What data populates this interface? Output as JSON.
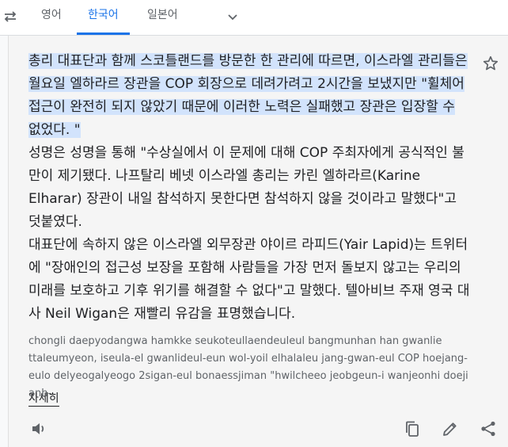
{
  "header": {
    "tabs": [
      {
        "label": "영어",
        "active": false
      },
      {
        "label": "한국어",
        "active": true
      },
      {
        "label": "일본어",
        "active": false
      }
    ],
    "swap_icon": "swap-icon",
    "more_languages_icon": "chevron-down-icon"
  },
  "translation": {
    "highlighted": "총리 대표단과 함께 스코틀랜드를 방문한 한 관리에 따르면, 이스라엘 관리들은 월요일 엘하라르 장관을 COP 회장으로 데려가려고 2시간을 보냈지만 \"휠체어 접근이 완전히 되지 않았기 때문에 이러한 노력은 실패했고 장관은 입장할 수 없었다. \"",
    "paragraph_1": "성명은 성명을 통해 \"수상실에서 이 문제에 대해 COP 주최자에게 공식적인 불만이 제기됐다. 나프탈리 베넷 이스라엘 총리는 카린 엘하라르(Karine Elharar) 장관이 내일 참석하지 못한다면 참석하지 않을 것이라고 말했다\"고 덧붙였다.",
    "paragraph_2": "대표단에 속하지 않은 이스라엘 외무장관 야이르 라피드(Yair Lapid)는 트위터에 \"장애인의 접근성 보장을 포함해 사람들을 가장 먼저 돌보지 않고는 우리의 미래를 보호하고 기후 위기를 해결할 수 없다\"고 말했다. 텔아비브 주재 영국 대사 Neil Wigan은 재빨리 유감을 표명했습니다.",
    "star_icon": "star-outline-icon"
  },
  "romanization": {
    "text": "chongli daepyodangwa hamkke seukoteullaendeuleul bangmunhan han gwanlie ttaleumyeon, iseula-el gwanlideul-eun wol-yoil elhalaleu jang-gwan-eul COP hoejang-eulo delyeogalyeogo 2sigan-eul bonaessjiman \"hwilcheeo jeobgeun-i wanjeonhi doeji anh-",
    "more_label": "자세히"
  },
  "footer": {
    "icons": [
      "speaker-icon",
      "copy-icon",
      "edit-icon",
      "share-icon"
    ]
  },
  "colors": {
    "accent": "#1a73e8",
    "highlight": "#d2e3fc",
    "text": "#202124",
    "muted": "#5f6368"
  }
}
